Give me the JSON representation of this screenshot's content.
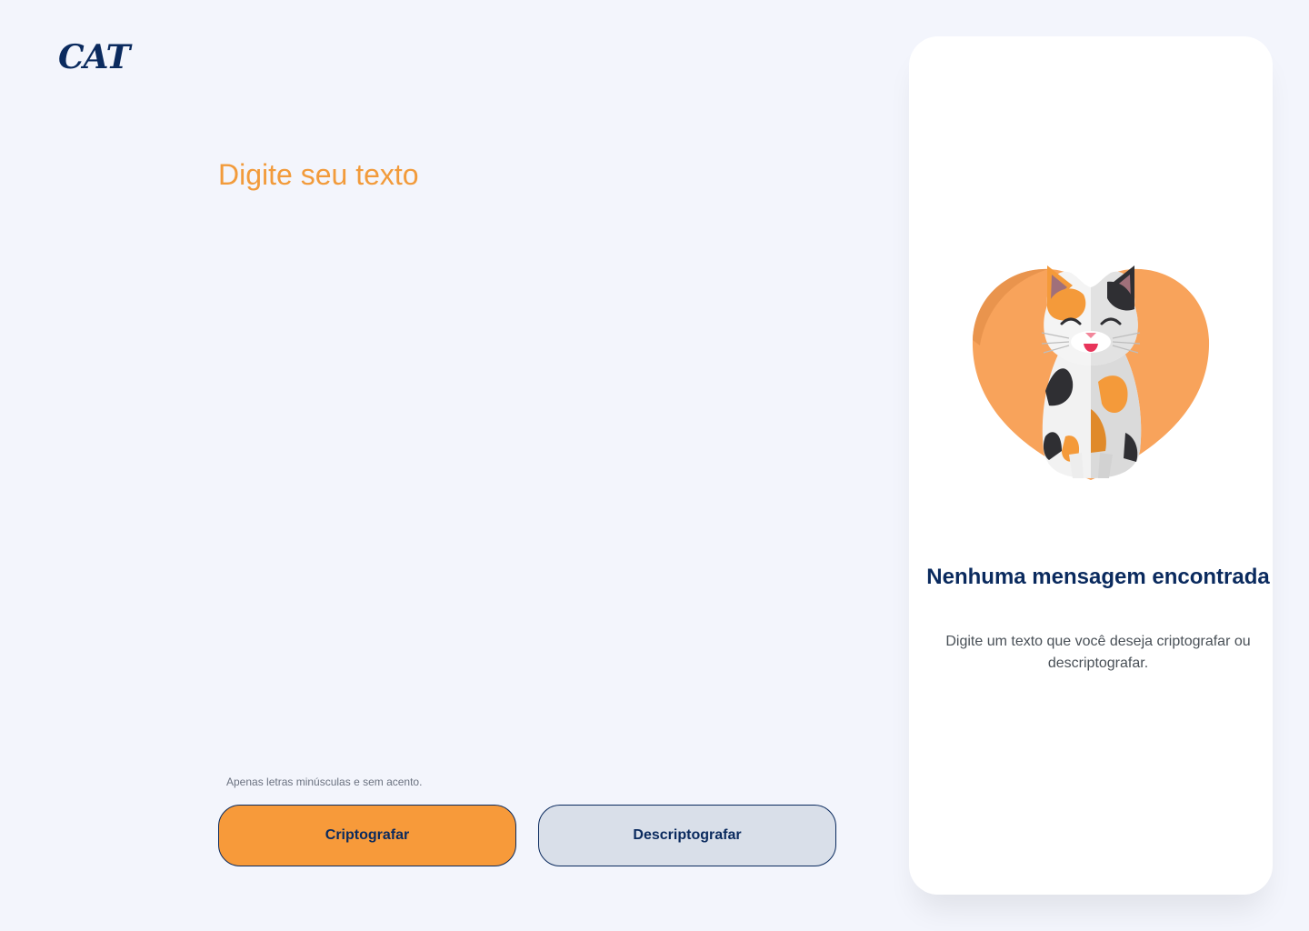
{
  "brand": {
    "logo_text": "CAT"
  },
  "editor": {
    "placeholder": "Digite seu texto",
    "hint": "Apenas letras minúsculas e sem acento."
  },
  "actions": {
    "encrypt_label": "Criptografar",
    "decrypt_label": "Descriptografar"
  },
  "output_panel": {
    "title": "Nenhuma mensagem encontrada",
    "subtitle": "Digite um texto que você deseja criptografar ou descriptografar.",
    "illustration": "calico-cat-heart-illustration"
  },
  "colors": {
    "background": "#F3F5FC",
    "accent_orange": "#F79A3A",
    "navy": "#0A2A5E",
    "secondary_button": "#D9DFE9",
    "panel": "#FFFFFF"
  }
}
